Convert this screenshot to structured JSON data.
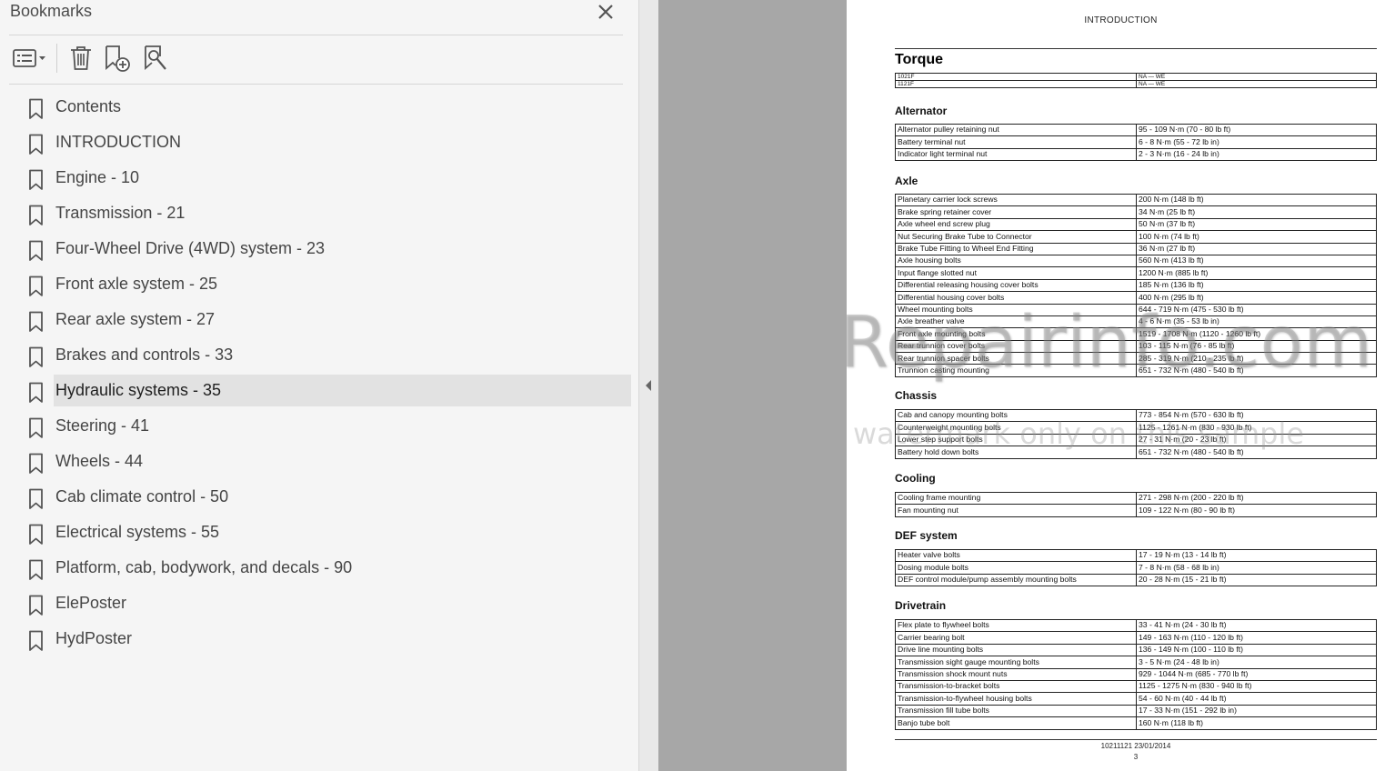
{
  "bookmarks_panel": {
    "title": "Bookmarks",
    "toolbar": {
      "options_icon": "list-options-icon",
      "delete_icon": "trash-icon",
      "new_bookmark_icon": "bookmark-add-icon",
      "new_from_structure_icon": "bookmark-search-icon"
    },
    "items": [
      {
        "label": "Contents"
      },
      {
        "label": "INTRODUCTION"
      },
      {
        "label": "Engine - 10"
      },
      {
        "label": "Transmission - 21"
      },
      {
        "label": "Four-Wheel Drive (4WD) system - 23"
      },
      {
        "label": "Front axle system - 25"
      },
      {
        "label": "Rear axle system - 27"
      },
      {
        "label": "Brakes and controls - 33"
      },
      {
        "label": "Hydraulic systems - 35",
        "selected": true
      },
      {
        "label": "Steering - 41"
      },
      {
        "label": "Wheels - 44"
      },
      {
        "label": "Cab climate control - 50"
      },
      {
        "label": "Electrical systems - 55"
      },
      {
        "label": "Platform, cab, bodywork, and decals - 90"
      },
      {
        "label": "ElePoster"
      },
      {
        "label": "HydPoster"
      }
    ],
    "selected_bg": "#e2e2e2"
  },
  "document": {
    "header": "INTRODUCTION",
    "title": "Torque",
    "model_rows": [
      [
        "1021F",
        "NA — WE"
      ],
      [
        "1121F",
        "NA — WE"
      ]
    ],
    "sections": [
      {
        "title": "Alternator",
        "rows": [
          [
            "Alternator pulley retaining nut",
            "95 - 109 N·m (70 - 80 lb ft)"
          ],
          [
            "Battery terminal nut",
            "6 - 8 N·m (55 - 72 lb in)"
          ],
          [
            "Indicator light terminal nut",
            "2 - 3 N·m (16 - 24 lb in)"
          ]
        ]
      },
      {
        "title": "Axle",
        "rows": [
          [
            "Planetary carrier lock screws",
            "200 N·m (148 lb ft)"
          ],
          [
            "Brake spring retainer cover",
            "34 N·m (25 lb ft)"
          ],
          [
            "Axle wheel end screw plug",
            "50 N·m (37 lb ft)"
          ],
          [
            "Nut Securing Brake Tube to Connector",
            "100 N·m (74 lb ft)"
          ],
          [
            "Brake Tube Fitting to Wheel End Fitting",
            "36 N·m (27 lb ft)"
          ],
          [
            "Axle housing bolts",
            "560 N·m (413 lb ft)"
          ],
          [
            "Input flange slotted nut",
            "1200 N·m (885 lb ft)"
          ],
          [
            "Differential releasing housing cover bolts",
            "185 N·m (136 lb ft)"
          ],
          [
            "Differential housing cover bolts",
            "400 N·m (295 lb ft)"
          ],
          [
            "Wheel mounting bolts",
            "644 - 719 N·m (475 - 530 lb ft)"
          ],
          [
            "Axle breather valve",
            "4 - 6 N·m (35 - 53 lb in)"
          ],
          [
            "Front axle mounting bolts",
            "1519 - 1708 N·m (1120 - 1260 lb ft)"
          ],
          [
            "Rear trunnion cover bolts",
            "103 - 115 N·m (76 - 85 lb ft)"
          ],
          [
            "Rear trunnion spacer bolts",
            "285 - 319 N·m (210 - 235 lb ft)"
          ],
          [
            "Trunnion casting mounting",
            "651 - 732 N·m (480 - 540 lb ft)"
          ]
        ]
      },
      {
        "title": "Chassis",
        "rows": [
          [
            "Cab and canopy mounting bolts",
            "773 - 854 N·m (570 - 630 lb ft)"
          ],
          [
            "Counterweight mounting bolts",
            "1125 - 1261 N·m (830 - 930 lb ft)"
          ],
          [
            "Lower step support bolts",
            "27 - 31 N·m (20 - 23 lb ft)"
          ],
          [
            "Battery hold down bolts",
            "651 - 732 N·m (480 - 540 lb ft)"
          ]
        ]
      },
      {
        "title": "Cooling",
        "rows": [
          [
            "Cooling frame mounting",
            "271 - 298 N·m (200 - 220 lb ft)"
          ],
          [
            "Fan mounting nut",
            "109 - 122 N·m (80 - 90 lb ft)"
          ]
        ]
      },
      {
        "title": "DEF system",
        "rows": [
          [
            "Heater valve bolts",
            "17 - 19 N·m (13 - 14 lb ft)"
          ],
          [
            "Dosing module bolts",
            "7 - 8 N·m (58 - 68 lb in)"
          ],
          [
            "DEF control module/pump assembly mounting bolts",
            "20 - 28 N·m (15 - 21 lb ft)"
          ]
        ]
      },
      {
        "title": "Drivetrain",
        "rows": [
          [
            "Flex plate to flywheel bolts",
            "33 - 41 N·m (24 - 30 lb ft)"
          ],
          [
            "Carrier bearing bolt",
            "149 - 163 N·m (110 - 120 lb ft)"
          ],
          [
            "Drive line mounting bolts",
            "136 - 149 N·m (100 - 110 lb ft)"
          ],
          [
            "Transmission sight gauge mounting bolts",
            "3 - 5 N·m (24 - 48 lb in)"
          ],
          [
            "Transmission shock mount nuts",
            "929 - 1044 N·m (685 - 770 lb ft)"
          ],
          [
            "Transmission-to-bracket bolts",
            "1125 - 1275 N·m (830 - 940 lb ft)"
          ],
          [
            "Transmission-to-flywheel housing bolts",
            "54 - 60 N·m (40 - 44 lb ft)"
          ],
          [
            "Transmission fill tube bolts",
            "17 - 33 N·m (151 - 292 lb in)"
          ],
          [
            "Banjo tube bolt",
            "160 N·m (118 lb ft)"
          ]
        ]
      }
    ],
    "footer": "10211121 23/01/2014",
    "page_number": "3",
    "watermark_main": "eRepairinfo.com",
    "watermark_sub": "watermark only on this sample"
  }
}
